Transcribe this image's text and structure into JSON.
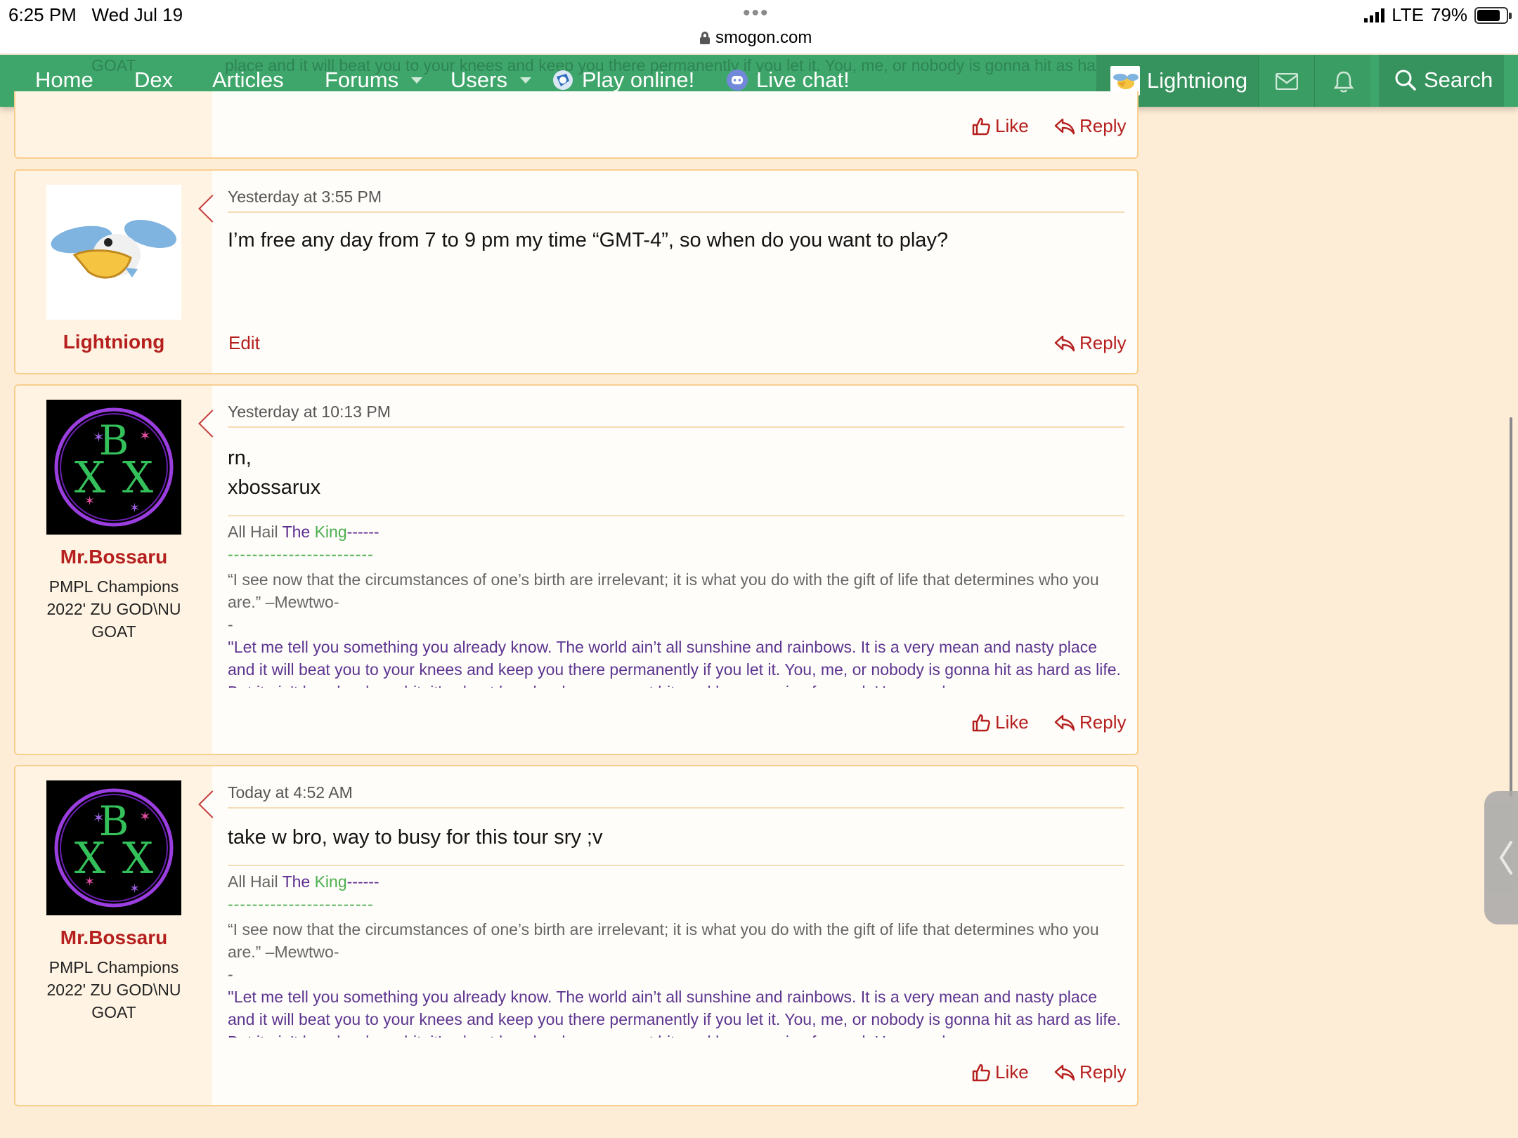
{
  "status_bar": {
    "time": "6:25 PM",
    "date": "Wed Jul 19",
    "dots": "•••",
    "url": "smogon.com",
    "network": "LTE",
    "battery": "79%",
    "battery_level": 0.79
  },
  "nav": {
    "ghost_text": "place and it will beat you to your knees and keep you there permanently if you let it. You, me, or nobody is gonna hit as hard as life. But it ain't how hard you hit; it's about how hard you can get hit and keep moving forward. How much you",
    "ghost_goat": "GOAT",
    "items": [
      "Home",
      "Dex",
      "Articles",
      "Forums",
      "Users",
      "Play online!",
      "Live chat!"
    ],
    "user": "Lightniong",
    "search": "Search"
  },
  "top_post": {
    "like": "Like",
    "reply": "Reply"
  },
  "posts": [
    {
      "username": "Lightniong",
      "date": "Yesterday at 3:55 PM",
      "body": "I’m free any day from 7 to 9 pm my time “GMT-4”, so when do you want to play?",
      "edit": "Edit",
      "reply": "Reply"
    },
    {
      "username": "Mr.Bossaru",
      "usertitle": "PMPL Champions 2022' ZU GOD\\NU GOAT",
      "date": "Yesterday at 10:13 PM",
      "body_lines": [
        "rn,",
        "xbossarux"
      ],
      "like": "Like",
      "reply": "Reply"
    },
    {
      "username": "Mr.Bossaru",
      "usertitle": "PMPL Champions 2022' ZU GOD\\NU GOAT",
      "date": "Today at 4:52 AM",
      "body": "take w bro, way to busy for this tour sry ;v",
      "like": "Like",
      "reply": "Reply"
    }
  ],
  "signature": {
    "hail_1": "All Hail",
    "hail_2": "The",
    "hail_3": "King",
    "hail_dashes": "------",
    "dash_line": "------------------------",
    "quote1": "“I see now that the circumstances of one’s birth are irrelevant; it is what you do with the gift of life that determines who you are.” –Mewtwo-",
    "dash": "-",
    "quote2": "''Let me tell you something you already know. The world ain’t all sunshine and rainbows. It is a very mean and nasty place and it will beat you to your knees and keep you there permanently if you let it. You, me, or nobody is gonna hit as hard as life. But it ain't how hard you hit; it's about how hard you can get hit, and keep moving forward. How much you"
  },
  "colors": {
    "nav_green": "#3ea66a",
    "link_red": "#b5201f",
    "page_bg": "#fdecd6",
    "border": "#f7cf8f"
  }
}
